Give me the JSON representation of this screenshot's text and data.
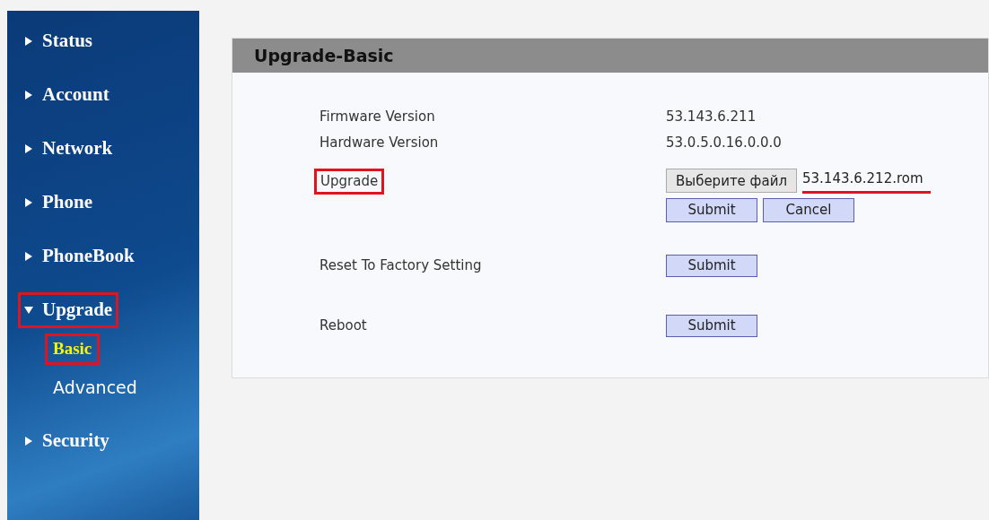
{
  "sidebar": {
    "items": [
      {
        "label": "Status",
        "expanded": false,
        "highlighted": false
      },
      {
        "label": "Account",
        "expanded": false,
        "highlighted": false
      },
      {
        "label": "Network",
        "expanded": false,
        "highlighted": false
      },
      {
        "label": "Phone",
        "expanded": false,
        "highlighted": false
      },
      {
        "label": "PhoneBook",
        "expanded": false,
        "highlighted": false
      },
      {
        "label": "Upgrade",
        "expanded": true,
        "highlighted": true,
        "children": [
          {
            "label": "Basic",
            "selected": true,
            "highlighted": true
          },
          {
            "label": "Advanced",
            "selected": false,
            "highlighted": false
          }
        ]
      },
      {
        "label": "Security",
        "expanded": false,
        "highlighted": false
      }
    ]
  },
  "panel": {
    "title": "Upgrade-Basic",
    "rows": [
      {
        "kind": "info",
        "label": "Firmware Version",
        "value": "53.143.6.211"
      },
      {
        "kind": "info",
        "label": "Hardware Version",
        "value": "53.0.5.0.16.0.0.0"
      },
      {
        "kind": "file",
        "label": "Upgrade",
        "highlighted": true,
        "file_button": "Выберите файл",
        "file_name": "53.143.6.212.rom",
        "underlined": true,
        "buttons": [
          "Submit",
          "Cancel"
        ]
      },
      {
        "kind": "action",
        "label": "Reset To Factory Setting",
        "button": "Submit"
      },
      {
        "kind": "action",
        "label": "Reboot",
        "button": "Submit"
      }
    ]
  }
}
